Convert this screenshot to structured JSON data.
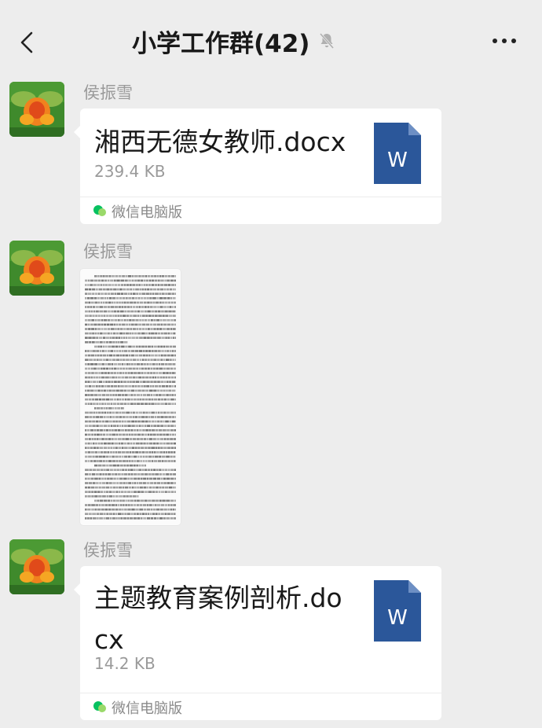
{
  "header": {
    "back_icon": "chevron-left-icon",
    "title": "小学工作群(42)",
    "mute_icon": "bell-muted-icon",
    "more_icon": "more-dots-icon"
  },
  "messages": [
    {
      "sender": "侯振雪",
      "type": "file",
      "file_name": "湘西无德女教师.docx",
      "file_size": "239.4 KB",
      "file_icon": "word-doc-icon",
      "file_icon_letter": "W",
      "client": "微信电脑版"
    },
    {
      "sender": "侯振雪",
      "type": "image",
      "image_desc": "document-page-image"
    },
    {
      "sender": "侯振雪",
      "type": "file",
      "file_name": "主题教育案例剖析.docx",
      "file_size": "14.2 KB",
      "file_icon": "word-doc-icon",
      "file_icon_letter": "W",
      "client": "微信电脑版"
    }
  ],
  "colors": {
    "background": "#ededed",
    "card": "#ffffff",
    "word_blue": "#2b579a",
    "sender_gray": "#9a9a9a",
    "wechat_green": "#07c160"
  }
}
